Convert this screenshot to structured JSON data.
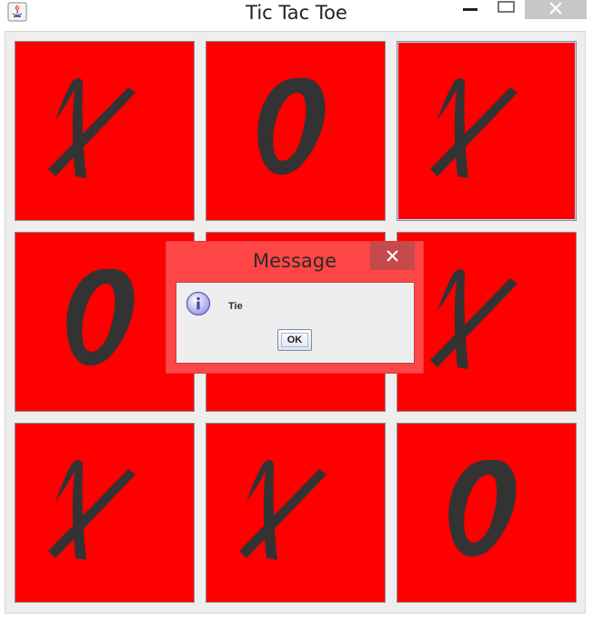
{
  "window": {
    "title": "Tic Tac Toe"
  },
  "board": {
    "cells": [
      "X",
      "O",
      "X",
      "O",
      "",
      "X",
      "X",
      "X",
      "O"
    ],
    "mark_color": "#333333",
    "cell_color": "#ff0000"
  },
  "dialog": {
    "title": "Message",
    "message": "Tie",
    "ok_label": "OK",
    "icon": "info-icon"
  }
}
